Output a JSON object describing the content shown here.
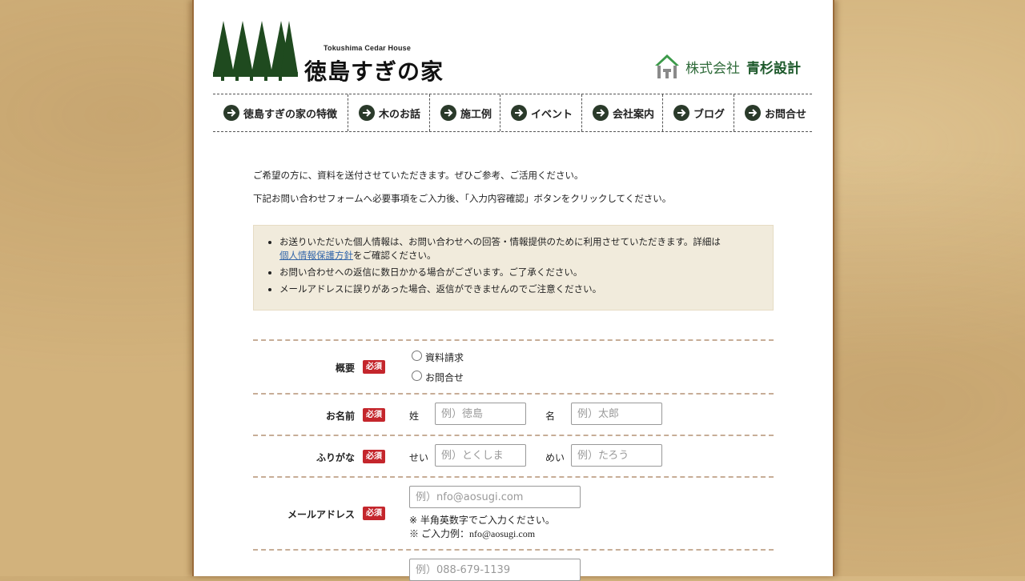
{
  "header": {
    "logo_subtitle": "Tokushima Cedar House",
    "logo_title": "徳島すぎの家",
    "company_kind": "株式会社",
    "company_name": "青杉設計"
  },
  "nav": [
    {
      "label": "徳島すぎの家の特徴"
    },
    {
      "label": "木のお話"
    },
    {
      "label": "施工例"
    },
    {
      "label": "イベント"
    },
    {
      "label": "会社案内"
    },
    {
      "label": "ブログ"
    },
    {
      "label": "お問合せ"
    }
  ],
  "intro": {
    "line1": "ご希望の方に、資料を送付させていただきます。ぜひご参考、ご活用ください。",
    "line2": "下記お問い合わせフォームへ必要事項をご入力後、「入力内容確認」ボタンをクリックしてください。"
  },
  "notice": {
    "item1_text": "お送りいただいた個人情報は、お問い合わせへの回答・情報提供のために利用させていただきます。詳細は",
    "item1_link": "個人情報保護方針",
    "item1_suffix": "をご確認ください。",
    "item2": "お問い合わせへの返信に数日かかる場合がございます。ご了承ください。",
    "item3": "メールアドレスに誤りがあった場合、返信ができませんのでご注意ください。"
  },
  "form": {
    "required_badge": "必須",
    "summary": {
      "label": "概要",
      "options": [
        "資料請求",
        "お問合せ"
      ]
    },
    "name": {
      "label": "お名前",
      "last_label": "姓",
      "last_placeholder": "例）徳島",
      "first_label": "名",
      "first_placeholder": "例）太郎"
    },
    "kana": {
      "label": "ふりがな",
      "last_label": "せい",
      "last_placeholder": "例）とくしま",
      "first_label": "めい",
      "first_placeholder": "例）たろう"
    },
    "email": {
      "label": "メールアドレス",
      "placeholder": "例）nfo@aosugi.com",
      "note1": "※ 半角英数字でご入力ください。",
      "note2": "※ ご入力例：nfo@aosugi.com"
    },
    "phone": {
      "placeholder": "例）088-679-1139"
    }
  },
  "colors": {
    "logo_green": "#1f4a1f",
    "company_green": "#1e5a2c",
    "required_red": "#c4262c",
    "notice_bg": "#f1ebdc",
    "divider": "#c7ad97"
  }
}
